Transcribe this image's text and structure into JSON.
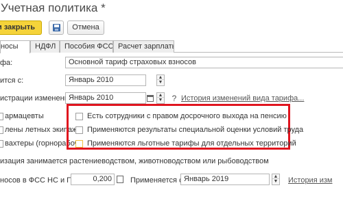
{
  "window": {
    "title": "Учетная политика *"
  },
  "toolbar": {
    "save_close_label": "и закрыть",
    "cancel_label": "Отмена"
  },
  "tabs": [
    {
      "label": "е взносы",
      "active": true
    },
    {
      "label": "НДФЛ",
      "active": false
    },
    {
      "label": "Пособия ФСС",
      "active": false
    },
    {
      "label": "Расчет зарплаты",
      "active": false
    }
  ],
  "form": {
    "tariff": {
      "label": "фа:",
      "value": "Основной тариф страховых взносов"
    },
    "applies_from": {
      "label": "ится с:",
      "value": "Январь 2010"
    },
    "registration": {
      "label": "истрации изменений:",
      "value": "Январь 2010"
    },
    "history_link": "История изменений вида тарифа...",
    "left_labels": {
      "pharmacists": "армацевты",
      "flight_crews": "лены летных экипаже",
      "shift_workers": "вахтеры (горнорабоче"
    },
    "checkboxes": [
      {
        "label": "Есть сотрудники с правом досрочного выхода на пенсию",
        "checked": false
      },
      {
        "label": "Применяются результаты специальной оценки условий труда",
        "checked": false
      },
      {
        "label": "Применяются льготные тарифы для отдельных территорий",
        "checked": false
      }
    ],
    "agriculture_text": "изация занимается растениеводством, животноводством или рыбоводством",
    "fss": {
      "label": "носов в ФСС НС и ПЗ:",
      "value": "0,200",
      "applies_label": "Применяется с:",
      "applies_value": "Январь 2019",
      "history_link": "История изм"
    }
  },
  "colors": {
    "accent_button": "#f5d33a",
    "highlight_frame": "#e0141e",
    "focus_checkbox": "#f0c040"
  }
}
